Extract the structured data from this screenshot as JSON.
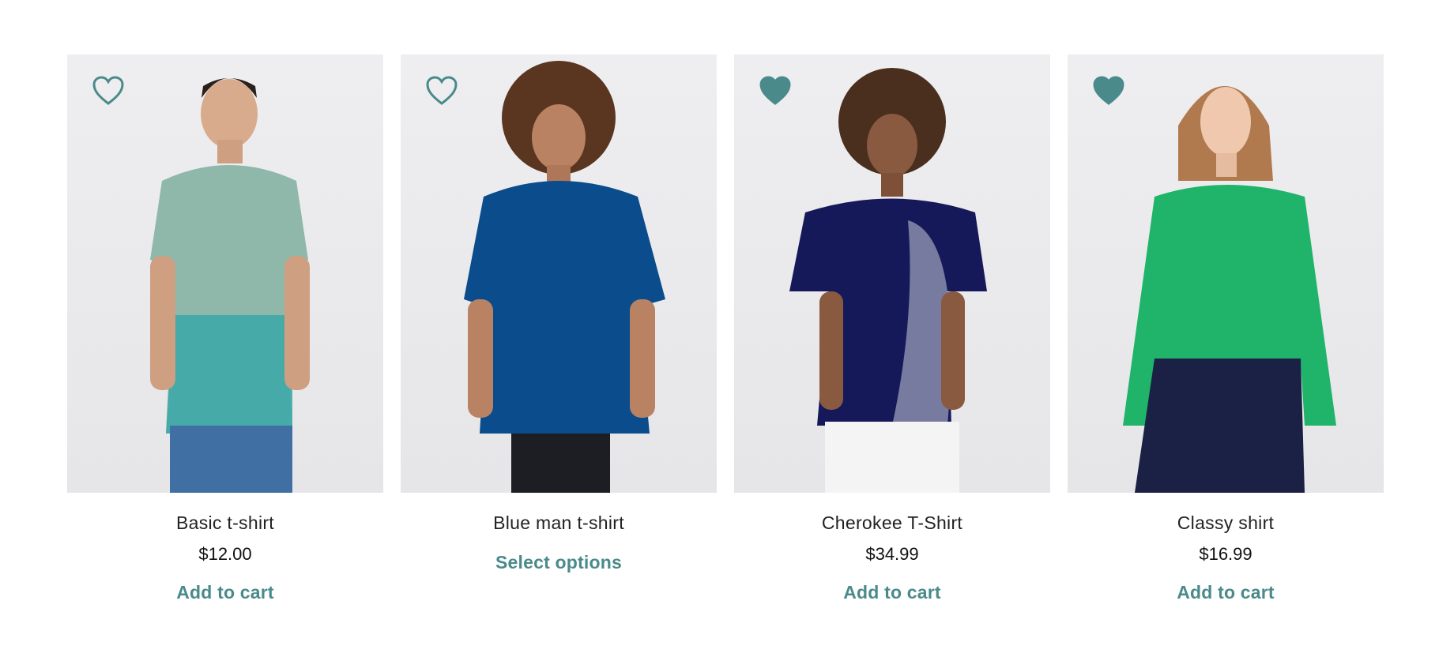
{
  "colors": {
    "accent": "#4a8a8a"
  },
  "products": [
    {
      "name": "Basic t-shirt",
      "price": "$12.00",
      "action": "Add to cart",
      "wishlisted": false,
      "shirt_color": "#8fb8aa"
    },
    {
      "name": "Blue man t-shirt",
      "price": "",
      "action": "Select options",
      "wishlisted": false,
      "shirt_color": "#0a4c8c"
    },
    {
      "name": "Cherokee T-Shirt",
      "price": "$34.99",
      "action": "Add to cart",
      "wishlisted": true,
      "shirt_color": "#15195a"
    },
    {
      "name": "Classy shirt",
      "price": "$16.99",
      "action": "Add to cart",
      "wishlisted": true,
      "shirt_color": "#1fb46a"
    }
  ]
}
